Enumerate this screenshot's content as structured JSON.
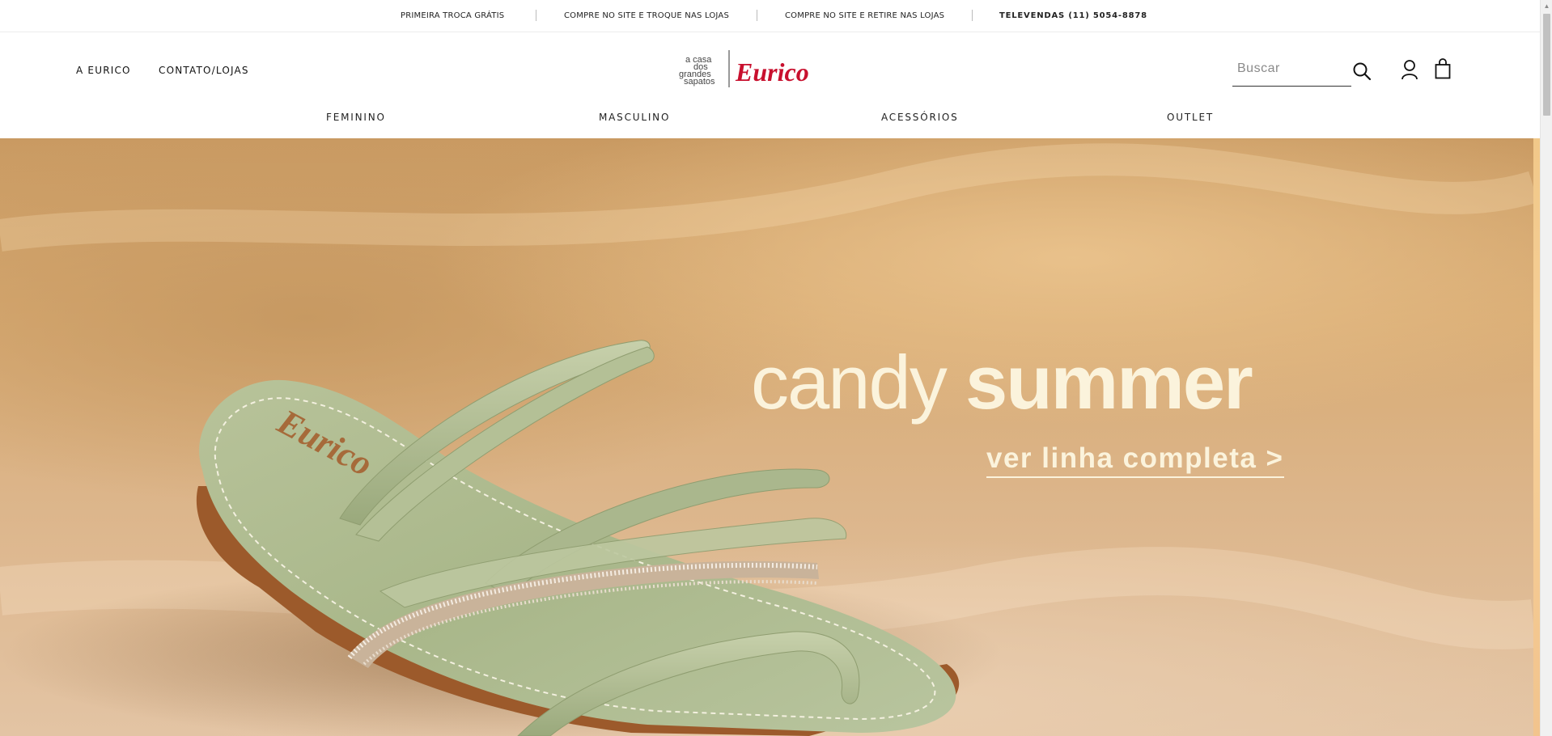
{
  "topbar": {
    "items": [
      "PRIMEIRA TROCA GRÁTIS",
      "COMPRE NO SITE E TROQUE NAS LOJAS",
      "COMPRE NO SITE E RETIRE NAS LOJAS",
      "TELEVENDAS (11) 5054-8878"
    ]
  },
  "header": {
    "links": {
      "about": "A EURICO",
      "contact": "CONTATO/LOJAS"
    },
    "logo": {
      "tagline_lines": [
        "a casa",
        "dos",
        "grandes",
        "sapatos"
      ],
      "brand": "Eurico",
      "brand_color": "#c8102e"
    },
    "search": {
      "placeholder": "Buscar",
      "value": ""
    },
    "icons": {
      "search": "search-icon",
      "account": "user-icon",
      "cart": "shopping-bag-icon"
    }
  },
  "nav": {
    "items": [
      "FEMININO",
      "MASCULINO",
      "ACESSÓRIOS",
      "OUTLET"
    ]
  },
  "hero": {
    "title_light": "candy",
    "title_bold": "summer",
    "cta": "ver linha completa >",
    "insole_brand": "Eurico",
    "text_color": "#fbf3dc"
  }
}
